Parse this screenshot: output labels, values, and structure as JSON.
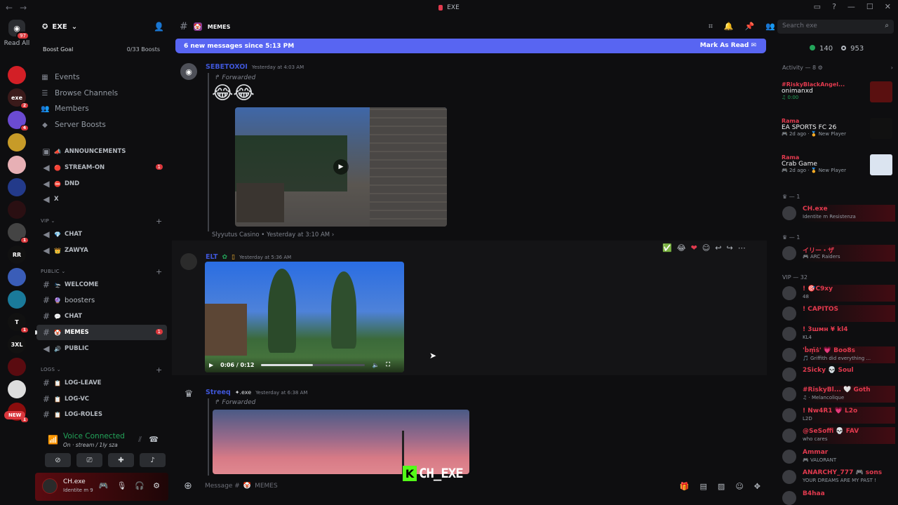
{
  "titlebar": {
    "title": "EXE"
  },
  "rail": {
    "home_badge": "97",
    "read_all": "Read All",
    "new_label": "NEW",
    "servers": [
      {
        "label": "",
        "color": "#d31f26",
        "badge": ""
      },
      {
        "label": "exe",
        "color": "#3a1a1a",
        "badge": "2"
      },
      {
        "label": "",
        "color": "#6b4bd1",
        "badge": "4"
      },
      {
        "label": "",
        "color": "#c79b28",
        "badge": ""
      },
      {
        "label": "",
        "color": "#e7b0b5",
        "badge": ""
      },
      {
        "label": "",
        "color": "#233a8a",
        "badge": ""
      },
      {
        "label": "",
        "color": "#2a0f12",
        "badge": ""
      },
      {
        "label": "",
        "color": "#444",
        "badge": "1"
      },
      {
        "label": "RR",
        "color": "#111",
        "badge": ""
      },
      {
        "label": "",
        "color": "#3a5db8",
        "badge": ""
      },
      {
        "label": "",
        "color": "#1a7a9a",
        "badge": ""
      },
      {
        "label": "T",
        "color": "#111",
        "badge": "1"
      },
      {
        "label": "3XL",
        "color": "#111",
        "badge": ""
      },
      {
        "label": "",
        "color": "#5a0b10",
        "badge": ""
      },
      {
        "label": "",
        "color": "#ddd",
        "badge": ""
      },
      {
        "label": "",
        "color": "#8b0d0d",
        "badge": "1"
      }
    ]
  },
  "server": {
    "name": "EXE",
    "boost_goal": "Boost Goal",
    "boost_count": "0/33 Boosts",
    "nav": [
      "Events",
      "Browse Channels",
      "Members",
      "Server Boosts"
    ],
    "categories": {
      "vip": "VIP",
      "public": "PUBLIC",
      "logs": "LOGS"
    },
    "channels": [
      {
        "name": "ANNOUNCEMENTS",
        "emoji": "📣",
        "badge": ""
      },
      {
        "name": "STREAM-ON",
        "emoji": "🔴",
        "badge": "1"
      },
      {
        "name": "DND",
        "emoji": "⛔",
        "badge": ""
      },
      {
        "name": "X",
        "emoji": "",
        "badge": ""
      },
      {
        "name": "CHAT",
        "emoji": "💎",
        "badge": ""
      },
      {
        "name": "ZAWYA",
        "emoji": "👑",
        "badge": ""
      },
      {
        "name": "WELCOME",
        "emoji": "🛬",
        "badge": ""
      },
      {
        "name": "boosters",
        "emoji": "🔮",
        "badge": ""
      },
      {
        "name": "CHAT",
        "emoji": "💬",
        "badge": ""
      },
      {
        "name": "MEMES",
        "emoji": "🤡",
        "badge": "1"
      },
      {
        "name": "PUBLIC",
        "emoji": "🔊",
        "badge": ""
      },
      {
        "name": "LOG-LEAVE",
        "emoji": "📋",
        "badge": ""
      },
      {
        "name": "LOG-VC",
        "emoji": "📋",
        "badge": ""
      },
      {
        "name": "LOG-ROLES",
        "emoji": "📋",
        "badge": ""
      }
    ]
  },
  "voice": {
    "status": "Voice Connected",
    "sub": "On · stream / 1ly sza"
  },
  "user": {
    "name": "CH.exe",
    "status": "Identite m 9"
  },
  "channel_header": {
    "name": "MEMES"
  },
  "new_messages": {
    "text": "6 new messages since 5:13 PM",
    "action": "Mark As Read"
  },
  "messages": [
    {
      "username": "SEBETOXOI",
      "time": "Yesterday at 4:03 AM",
      "forwarded": "Forwarded",
      "emojis": "😂😂",
      "source": "Slyyutus Casino • Yesterday at 3:10 AM ›"
    },
    {
      "username": "ELT",
      "time": "Yesterday at 5:36 AM",
      "video_time": "0:06 / 0:12"
    },
    {
      "username": "Streeq",
      "tag": "✦.exe",
      "time": "Yesterday at 6:38 AM",
      "forwarded": "Forwarded"
    }
  ],
  "composer": {
    "placeholder": "Message #",
    "channel": "MEMES"
  },
  "watermark": {
    "letter": "K",
    "text": "CH_EXE"
  },
  "right": {
    "search_placeholder": "Search exe",
    "online": "140",
    "offline": "953",
    "activity_header": "Activity — 8",
    "activities": [
      {
        "user": "#RiskyBlackAngel...",
        "game": "onimanxd",
        "meta": "♫ 0:00",
        "meta_green": true,
        "art": "#5a1010"
      },
      {
        "user": "Rama",
        "game": "EA SPORTS FC 26",
        "meta": "🎮 2d ago · 🏅 New Player",
        "meta_green": false,
        "art": "#111"
      },
      {
        "user": "Rama",
        "game": "Crab Game",
        "meta": "🎮 2d ago · 🏅 New Player",
        "meta_green": false,
        "art": "#dbe4f0"
      }
    ],
    "group1": "— 1",
    "group2": "— 1",
    "vip_header": "VIP — 32",
    "members": [
      {
        "name": "CH.exe",
        "sub": "Identite m Resistenza",
        "banner": true
      },
      {
        "name": "イリー・ザ",
        "sub": "🎮 ARC Raiders",
        "banner": true
      },
      {
        "name": "! 🎯C9xy",
        "sub": "48",
        "banner": true
      },
      {
        "name": "! CAPITOS",
        "sub": "",
        "banner": true
      },
      {
        "name": "! 3шмн ¥ kl4",
        "sub": "KL4",
        "banner": false
      },
      {
        "name": "'ḃṃ̈ṡ' 💗 Boo8s",
        "sub": "🎵 Griffith did everything ...",
        "banner": true
      },
      {
        "name": "2Sicky 💀 Soul",
        "sub": "",
        "banner": false
      },
      {
        "name": "#RiskyBl... 🤍 Goth",
        "sub": "♫ · Melancolique",
        "banner": true
      },
      {
        "name": "! Nw4R1 💗 L2o",
        "sub": "L2D",
        "banner": true
      },
      {
        "name": "@SeSoffi 💀 FAV",
        "sub": "who cares",
        "banner": true
      },
      {
        "name": "Ammar",
        "sub": "🎮 VALORANT",
        "banner": false
      },
      {
        "name": "ANARCHY_777 🎮 sons",
        "sub": "YOUR DREAMS ARE MY PAST !",
        "banner": false
      },
      {
        "name": "B4haa",
        "sub": "",
        "banner": false
      }
    ]
  }
}
